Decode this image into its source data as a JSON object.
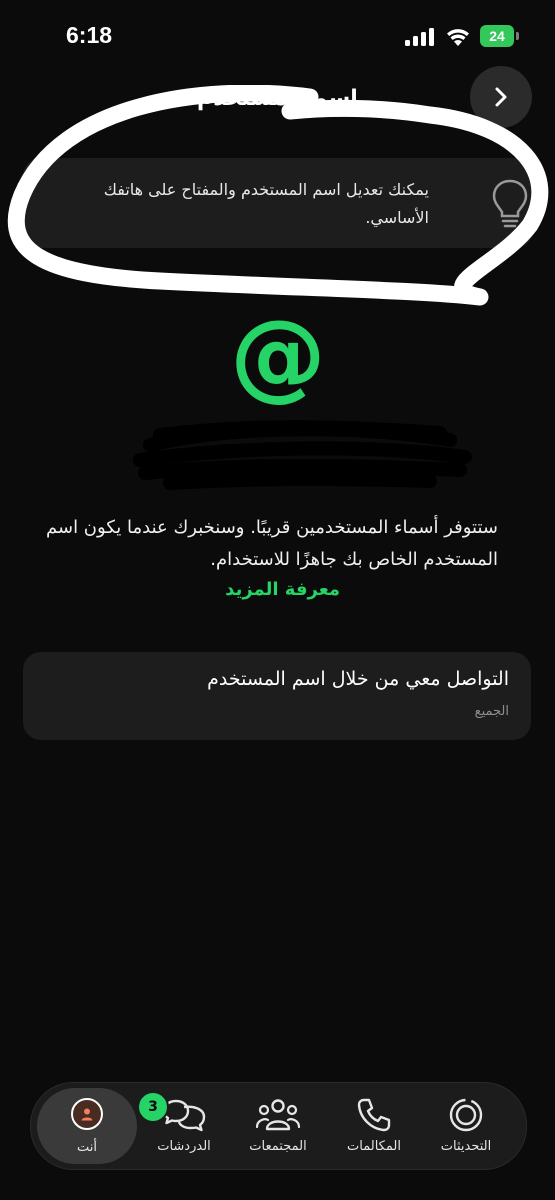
{
  "status_bar": {
    "time": "6:18",
    "battery": "24"
  },
  "header": {
    "title": "اسم المستخدم"
  },
  "tip": {
    "text": "يمكنك تعديل اسم المستخدم والمفتاح على هاتفك الأساسي."
  },
  "info": {
    "text": "ستتوفر أسماء المستخدمين قريبًا. وسنخبرك عندما يكون اسم المستخدم الخاص بك جاهزًا للاستخدام.",
    "learn_more": "معرفة المزيد"
  },
  "setting": {
    "title": "التواصل معي من خلال اسم المستخدم",
    "value": "الجميع"
  },
  "nav": {
    "you": "أنت",
    "chats": "الدردشات",
    "chats_badge": "3",
    "communities": "المجتمعات",
    "calls": "المكالمات",
    "updates": "التحديثات"
  },
  "colors": {
    "accent": "#25d366",
    "background": "#0b0b0b",
    "card": "#1d1d1d"
  }
}
